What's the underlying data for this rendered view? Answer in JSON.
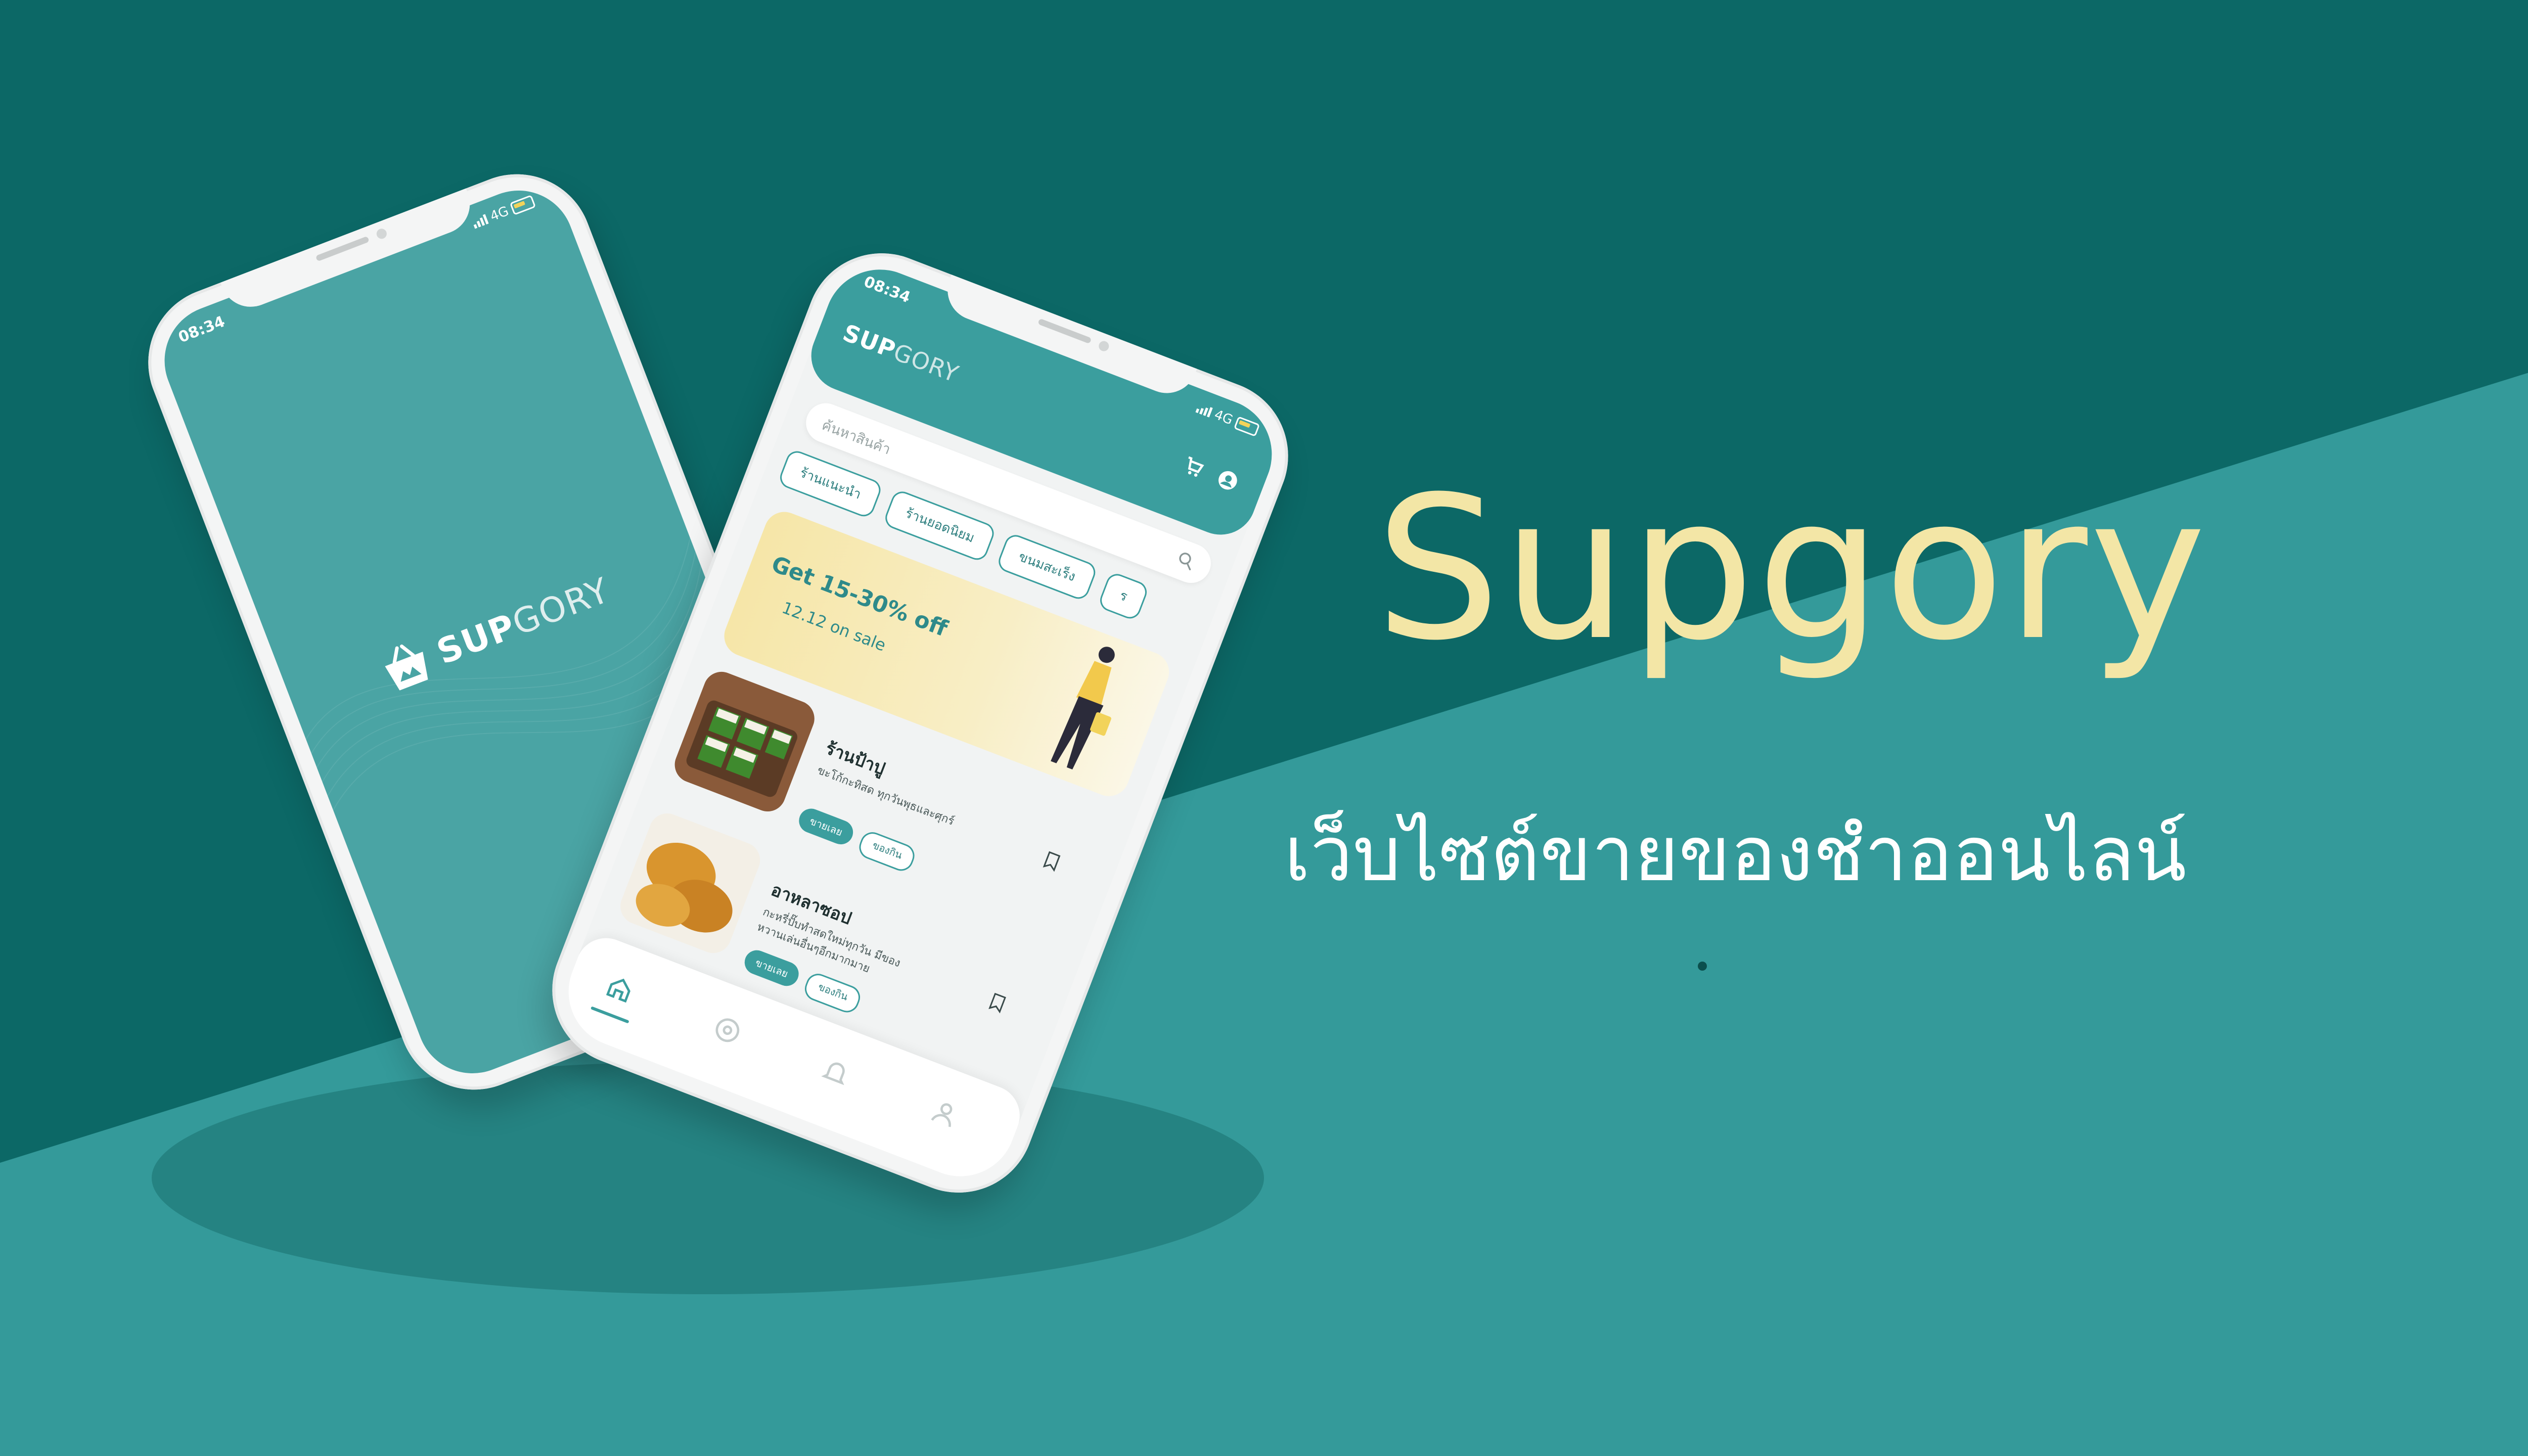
{
  "hero": {
    "title": "Supgory",
    "subtitle": "เว็บไซต์ขายของชำออนไลน์"
  },
  "status_bar": {
    "time": "08:34",
    "network": "4G"
  },
  "splash": {
    "logo_bold": "SUP",
    "logo_light": "GORY"
  },
  "app": {
    "logo_bold": "SUP",
    "logo_light": "GORY",
    "search_placeholder": "ค้นหาสินค้า",
    "chips": [
      "ร้านแนะนำ",
      "ร้านยอดนิยม",
      "ขนมสะเร็ง",
      "ร"
    ],
    "banner": {
      "headline": "Get 15-30% off",
      "subline": "12.12 on sale"
    },
    "cards": [
      {
        "name": "ร้านป้าปู",
        "desc": "ขะโก้กะทิสด ทุกวันพุธและศุกร์",
        "primary": "ขายเลย",
        "secondary": "ของกิน"
      },
      {
        "name": "อาหลาซอป",
        "desc": "กะหรี่ปั๊บทำสดใหม่ทุกวัน มีของหวานเล่นอื่นๆอีกมากมาย",
        "primary": "ขายเลย",
        "secondary": "ของกิน"
      }
    ],
    "nav": [
      "home-icon",
      "explore-icon",
      "bell-icon",
      "user-icon"
    ]
  },
  "colors": {
    "bg_dark": "#0c6866",
    "bg_light": "#349a9a",
    "accent": "#3b9e9e",
    "title_yellow": "#f3e6a6"
  }
}
